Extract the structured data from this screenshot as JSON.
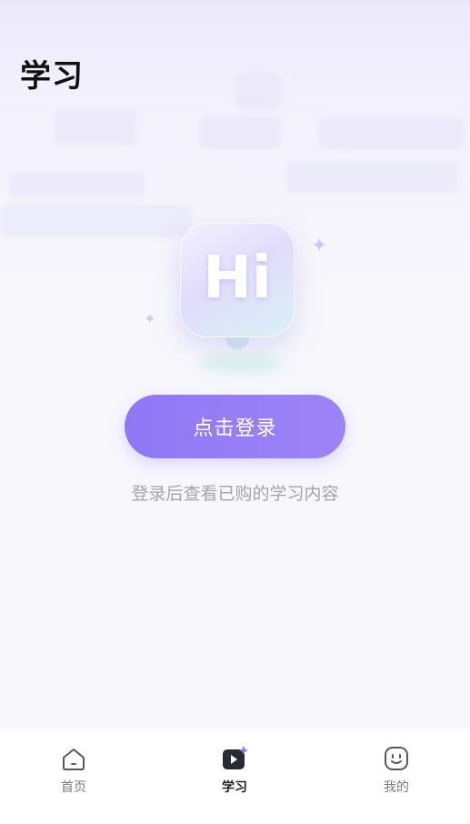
{
  "header": {
    "title": "学习"
  },
  "illustration": {
    "greeting": "Hi"
  },
  "login": {
    "button_label": "点击登录",
    "hint": "登录后查看已购的学习内容"
  },
  "tabbar": {
    "items": [
      {
        "label": "首页",
        "icon": "home-icon",
        "active": false
      },
      {
        "label": "学习",
        "icon": "study-play-icon",
        "active": true
      },
      {
        "label": "我的",
        "icon": "smiley-face-icon",
        "active": false
      }
    ]
  },
  "colors": {
    "accent": "#8f78f5",
    "title": "#111111",
    "hint": "#a3a3a8",
    "background": "#f7f7fc",
    "tab_inactive": "#7a7a7a",
    "tab_active": "#222222"
  }
}
